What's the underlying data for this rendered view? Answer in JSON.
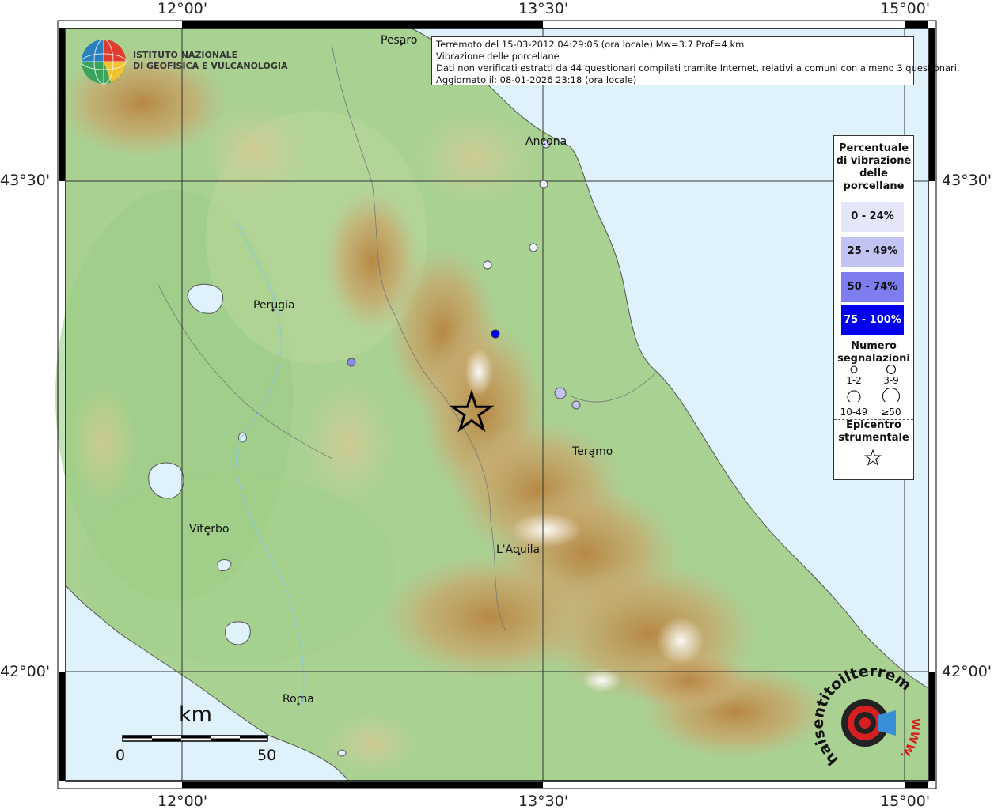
{
  "info": {
    "line1": "Terremoto del 15-03-2012 04:29:05 (ora locale) Mw=3.7 Prof=4 km",
    "line2": "Vibrazione delle porcellane",
    "line3": "Dati non verificati estratti da 44 questionari compilati tramite Internet, relativi a comuni con almeno 3 questionari.",
    "line4": "Aggiornato il: 08-01-2026 23:18 (ora locale)"
  },
  "coords": {
    "lon_12": "12°00'",
    "lon_1330": "13°30'",
    "lon_15": "15°00'",
    "lat_4330": "43°30'",
    "lat_42": "42°00'"
  },
  "cities": {
    "pesaro": "Pesaro",
    "ancona": "Ancona",
    "perugia": "Perugia",
    "teramo": "Teramo",
    "viterbo": "Viterbo",
    "laquila": "L'Aquila",
    "roma": "Roma"
  },
  "logo": {
    "line1": "ISTITUTO NAZIONALE",
    "line2": "DI GEOFISICA E VULCANOLOGIA"
  },
  "legend": {
    "title_lines": [
      "Percentuale",
      "di vibrazione",
      "delle",
      "porcellane"
    ],
    "classes": [
      {
        "label": "0 - 24%",
        "color": "#e6e6fa",
        "text_color": "#111111"
      },
      {
        "label": "25 - 49%",
        "color": "#c2c2f3",
        "text_color": "#111111"
      },
      {
        "label": "50 - 74%",
        "color": "#7d7df0",
        "text_color": "#111111"
      },
      {
        "label": "75 - 100%",
        "color": "#0000ee",
        "text_color": "#ffffff"
      }
    ],
    "count_title_lines": [
      "Numero",
      "segnalazioni"
    ],
    "counts": [
      "1-2",
      "3-9",
      "10-49",
      "≥50"
    ],
    "epicenter_lines": [
      "Epicentro",
      "strumentale"
    ]
  },
  "scale": {
    "unit": "km",
    "start": "0",
    "end": "50"
  },
  "stamp": {
    "text": "haisentitoilterremoto.it",
    "url": "WWW."
  },
  "colors": {
    "sea": "#dff1fb",
    "land_low": "#a8d08d",
    "mountain": "#c4975a"
  }
}
